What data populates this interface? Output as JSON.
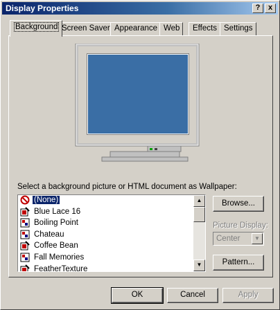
{
  "window": {
    "title": "Display Properties",
    "help_button": "?",
    "close_button": "x"
  },
  "tabs": [
    {
      "label": "Background",
      "selected": true
    },
    {
      "label": "Screen Saver"
    },
    {
      "label": "Appearance"
    },
    {
      "label": "Web"
    },
    {
      "label": "Effects"
    },
    {
      "label": "Settings"
    }
  ],
  "monitor": {
    "screen_color": "#3a6ea5"
  },
  "wallpaper": {
    "label": "Select a background picture or HTML document as Wallpaper:",
    "items": [
      {
        "label": "(None)",
        "icon": "no-symbol-icon",
        "selected": true
      },
      {
        "label": "Blue Lace 16",
        "icon": "paint-bitmap-icon"
      },
      {
        "label": "Boiling Point",
        "icon": "bitmap-icon"
      },
      {
        "label": "Chateau",
        "icon": "bitmap-icon"
      },
      {
        "label": "Coffee Bean",
        "icon": "paint-bitmap-icon"
      },
      {
        "label": "Fall Memories",
        "icon": "bitmap-icon"
      },
      {
        "label": "FeatherTexture",
        "icon": "paint-bitmap-icon"
      }
    ]
  },
  "buttons": {
    "browse": "Browse...",
    "pattern": "Pattern...",
    "ok": "OK",
    "cancel": "Cancel",
    "apply": "Apply"
  },
  "picture_display": {
    "label": "Picture Display:",
    "value": "Center"
  }
}
